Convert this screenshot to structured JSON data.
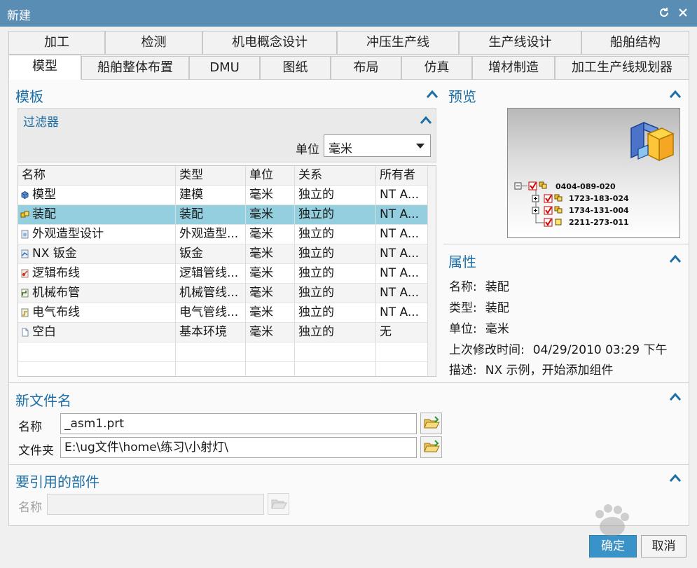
{
  "window": {
    "title": "新建",
    "refresh_icon": "refresh-icon",
    "close_icon": "close-icon"
  },
  "tabs_top": [
    "加工",
    "检测",
    "机电概念设计",
    "冲压生产线",
    "生产线设计",
    "船舶结构"
  ],
  "tabs_bottom": [
    "模型",
    "船舶整体布置",
    "DMU",
    "图纸",
    "布局",
    "仿真",
    "增材制造",
    "加工生产线规划器"
  ],
  "active_tab": "模型",
  "template": {
    "title": "模板",
    "filter": {
      "title": "过滤器",
      "unit_label": "单位",
      "unit_value": "毫米"
    },
    "columns": [
      "名称",
      "类型",
      "单位",
      "关系",
      "所有者"
    ],
    "rows": [
      {
        "name": "模型",
        "type": "建模",
        "unit": "毫米",
        "relation": "独立的",
        "owner": "NT A...",
        "icon": "model-icon"
      },
      {
        "name": "装配",
        "type": "装配",
        "unit": "毫米",
        "relation": "独立的",
        "owner": "NT A...",
        "icon": "assembly-icon"
      },
      {
        "name": "外观造型设计",
        "type": "外观造型...",
        "unit": "毫米",
        "relation": "独立的",
        "owner": "NT A...",
        "icon": "shape-studio-icon"
      },
      {
        "name": "NX 钣金",
        "type": "钣金",
        "unit": "毫米",
        "relation": "独立的",
        "owner": "NT A...",
        "icon": "sheet-metal-icon"
      },
      {
        "name": "逻辑布线",
        "type": "逻辑管线...",
        "unit": "毫米",
        "relation": "独立的",
        "owner": "NT A...",
        "icon": "logical-routing-icon"
      },
      {
        "name": "机械布管",
        "type": "机械管线...",
        "unit": "毫米",
        "relation": "独立的",
        "owner": "NT A...",
        "icon": "mechanical-routing-icon"
      },
      {
        "name": "电气布线",
        "type": "电气管线...",
        "unit": "毫米",
        "relation": "独立的",
        "owner": "NT A...",
        "icon": "electrical-routing-icon"
      },
      {
        "name": "空白",
        "type": "基本环境",
        "unit": "毫米",
        "relation": "独立的",
        "owner": "无",
        "icon": "blank-icon"
      }
    ],
    "selected_row": 1
  },
  "preview": {
    "title": "预览",
    "tree": [
      "0404-089-020",
      "1723-183-024",
      "1734-131-004",
      "2211-273-011"
    ]
  },
  "properties": {
    "title": "属性",
    "items": [
      {
        "key": "名称:",
        "value": "装配"
      },
      {
        "key": "类型:",
        "value": "装配"
      },
      {
        "key": "单位:",
        "value": "毫米"
      },
      {
        "key": "上次修改时间:",
        "value": "04/29/2010 03:29 下午"
      },
      {
        "key": "描述:",
        "value": "NX 示例，开始添加组件"
      }
    ]
  },
  "new_file": {
    "title": "新文件名",
    "name_label": "名称",
    "name_value": "_asm1.prt",
    "folder_label": "文件夹",
    "folder_value": "E:\\ug文件\\home\\练习\\小射灯\\"
  },
  "referenced_part": {
    "title": "要引用的部件",
    "name_label": "名称",
    "name_value": ""
  },
  "buttons": {
    "ok": "确定",
    "cancel": "取消"
  },
  "colors": {
    "titlebar": "#5a8db4",
    "accent": "#1d6fa5",
    "selected_row": "#94cfe0",
    "ok_button": "#3a93c8"
  }
}
